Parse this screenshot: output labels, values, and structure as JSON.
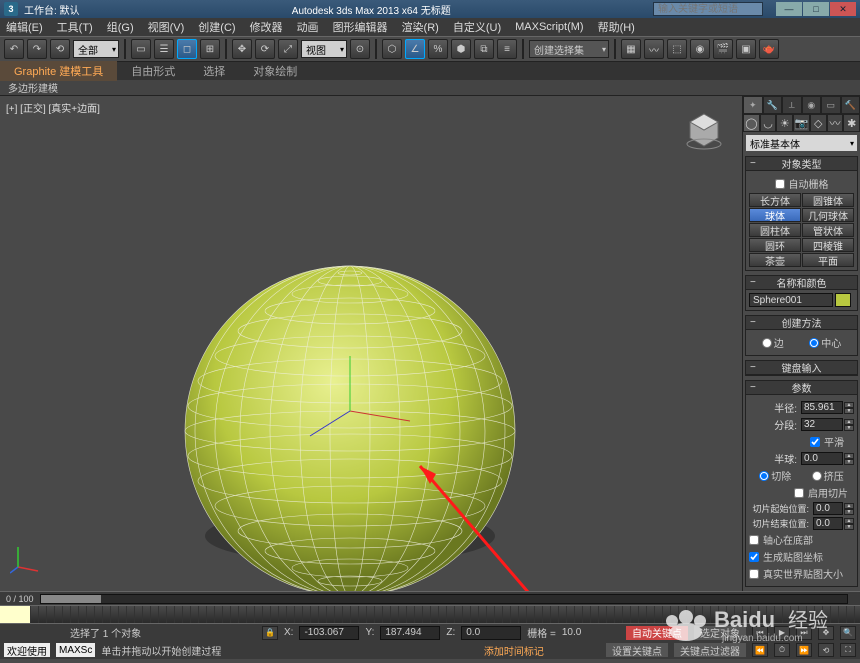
{
  "titlebar": {
    "workspace_label": "工作台: 默认",
    "app_title": "Autodesk 3ds Max 2013 x64   无标题",
    "search_placeholder": "输入关键字或短语"
  },
  "menu": [
    "编辑(E)",
    "工具(T)",
    "组(G)",
    "视图(V)",
    "创建(C)",
    "修改器",
    "动画",
    "图形编辑器",
    "渲染(R)",
    "自定义(U)",
    "MAXScript(M)",
    "帮助(H)"
  ],
  "ribbon": {
    "tabs": [
      "Graphite 建模工具",
      "自由形式",
      "选择",
      "对象绘制"
    ],
    "sub": "多边形建模"
  },
  "viewport": {
    "label": "[+] [正交] [真实+边面]"
  },
  "toolbar": {
    "layer_selector": "全部",
    "view_selector": "视图",
    "create_dropdown": "创建选择集"
  },
  "panel": {
    "category": "标准基本体",
    "rollouts": {
      "object_type": "对象类型",
      "autogrid": "自动栅格",
      "name_color": "名称和颜色",
      "create_method": "创建方法",
      "keyboard": "键盘输入",
      "params": "参数"
    },
    "objects": [
      "长方体",
      "圆锥体",
      "球体",
      "几何球体",
      "圆柱体",
      "管状体",
      "圆环",
      "四棱锥",
      "茶壶",
      "平面"
    ],
    "active_object": "球体",
    "object_name": "Sphere001",
    "create_method": {
      "edge": "边",
      "center": "中心"
    },
    "params": {
      "radius_label": "半径:",
      "radius": "85.961",
      "segments_label": "分段:",
      "segments": "32",
      "smooth": "平滑",
      "hemisphere_label": "半球:",
      "hemisphere": "0.0",
      "chop": "切除",
      "squash": "挤压",
      "slice_on": "启用切片",
      "slice_from_label": "切片起始位置:",
      "slice_from": "0.0",
      "slice_to_label": "切片结束位置:",
      "slice_to": "0.0",
      "base_pivot": "轴心在底部",
      "gen_coords": "生成贴图坐标",
      "real_world": "真实世界贴图大小"
    }
  },
  "timeline": {
    "label": "0 / 100"
  },
  "status": {
    "selected": "选择了 1 个对象",
    "hint": "单击并拖动以开始创建过程",
    "x_label": "X:",
    "x": "-103.067",
    "y_label": "Y:",
    "y": "187.494",
    "z_label": "Z:",
    "z": "0.0",
    "grid_label": "栅格 =",
    "grid": "10.0",
    "add_time": "添加时间标记",
    "auto_key": "自动关键点",
    "set_key": "设置关键点",
    "key_filter": "关键点过滤器",
    "sel_locked": "选定对象",
    "welcome": "欢迎使用",
    "maxs": "MAXSc"
  },
  "watermark": {
    "brand": "Baidu",
    "sub": "经验",
    "url": "jingyan.baidu.com"
  }
}
